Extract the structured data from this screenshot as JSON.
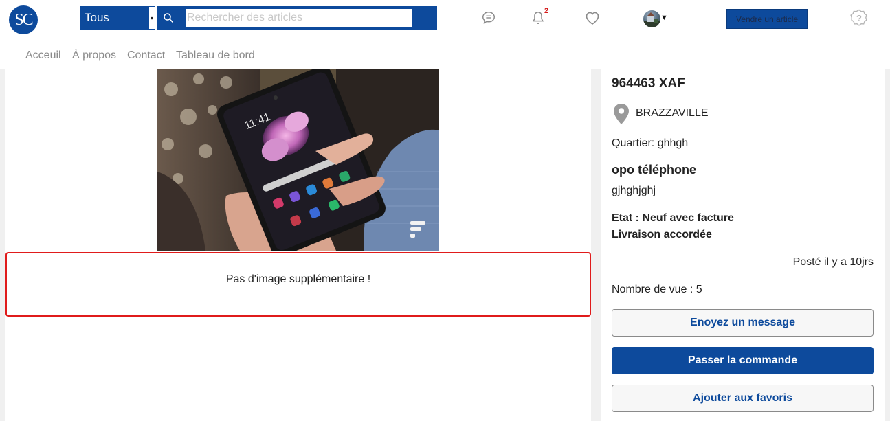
{
  "header": {
    "logo_text": "SC",
    "category_select": {
      "value": "Tous"
    },
    "search": {
      "placeholder": "Rechercher des articles",
      "value": ""
    },
    "notification_count": "2",
    "sell_button_label": "Vendre un article",
    "icons": [
      "messages-icon",
      "bell-icon",
      "heart-icon",
      "help-icon",
      "search-icon"
    ]
  },
  "nav": {
    "links": [
      "Acceuil",
      "À propos",
      "Contact",
      "Tableau de bord"
    ]
  },
  "main": {
    "no_extra_image_text": "Pas d'image supplémentaire !"
  },
  "details": {
    "price": "964463 XAF",
    "city": "BRAZZAVILLE",
    "quarter": "Quartier: ghhgh",
    "title": "opo téléphone",
    "description": "gjhghjghj",
    "etat": "Etat : Neuf avec facture",
    "livraison": "Livraison accordée",
    "posted": "Posté il y a 10jrs",
    "views": "Nombre de vue : 5",
    "buttons": {
      "message": "Enoyez un message",
      "order": "Passer la commande",
      "favorite": "Ajouter aux favoris"
    }
  },
  "colors": {
    "brand": "#0d4a9c",
    "alert": "#e01b1b",
    "badge": "#d51a1a"
  }
}
